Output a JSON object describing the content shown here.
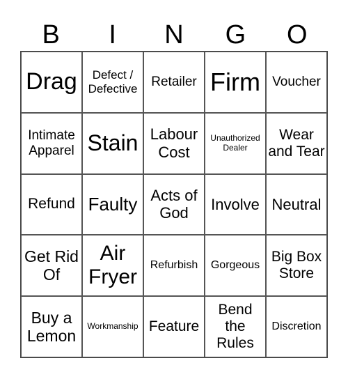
{
  "header": [
    "B",
    "I",
    "N",
    "G",
    "O"
  ],
  "cells": [
    "Drag",
    "Defect / Defective",
    "Retailer",
    "Firm",
    "Voucher",
    "Intimate Apparel",
    "Stain",
    "Labour Cost",
    "Unauthorized Dealer",
    "Wear and Tear",
    "Refund",
    "Faulty",
    "Acts of God",
    "Involve",
    "Neutral",
    "Get Rid Of",
    "Air Fryer",
    "Refurbish",
    "Gorgeous",
    "Big Box Store",
    "Buy a Lemon",
    "Workmanship",
    "Feature",
    "Bend the Rules",
    "Discretion"
  ]
}
